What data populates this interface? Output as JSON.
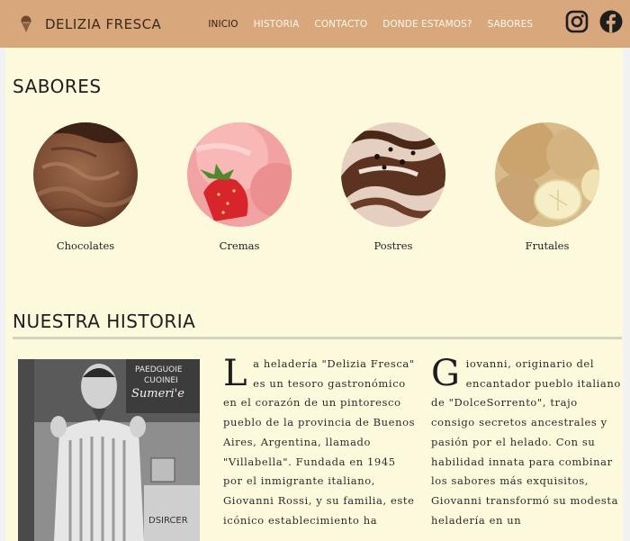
{
  "brand": {
    "name": "DELIZIA FRESCA",
    "icon": "ice-cream-icon"
  },
  "nav": {
    "items": [
      {
        "label": "INICIO",
        "active": true
      },
      {
        "label": "HISTORIA",
        "active": false
      },
      {
        "label": "CONTACTO",
        "active": false
      },
      {
        "label": "DONDE ESTAMOS?",
        "active": false
      },
      {
        "label": "SABORES",
        "active": false
      }
    ]
  },
  "social": {
    "icons": [
      "instagram-icon",
      "facebook-icon"
    ]
  },
  "sabores": {
    "title": "SABORES",
    "items": [
      {
        "label": "Chocolates",
        "image": "chocolate-ice-cream-image"
      },
      {
        "label": "Cremas",
        "image": "strawberry-ice-cream-image"
      },
      {
        "label": "Postres",
        "image": "dessert-swirl-ice-cream-image"
      },
      {
        "label": "Frutales",
        "image": "banana-ice-cream-image"
      }
    ]
  },
  "historia": {
    "title": "NUESTRA HISTORIA",
    "photo": "vintage-ice-cream-maker-photo",
    "col1": {
      "dropcap": "L",
      "text": "a heladería \"Delizia Fresca\" es un tesoro gastronómico en el corazón de un pintoresco pueblo de la provincia de Buenos Aires, Argentina, llamado \"Villabella\". Fundada en 1945 por el inmigrante italiano, Giovanni Rossi, y su familia, este icónico establecimiento ha"
    },
    "col2": {
      "dropcap": "G",
      "text": "iovanni, originario del encantador pueblo italiano de \"DolceSorrento\", trajo consigo secretos ancestrales y pasión por el helado. Con su habilidad innata para combinar los sabores más exquisitos, Giovanni transformó su modesta heladería en un"
    }
  },
  "colors": {
    "navbar": "#d9a77c",
    "background": "#fdf9dc",
    "nav_active": "#2b1d12"
  }
}
